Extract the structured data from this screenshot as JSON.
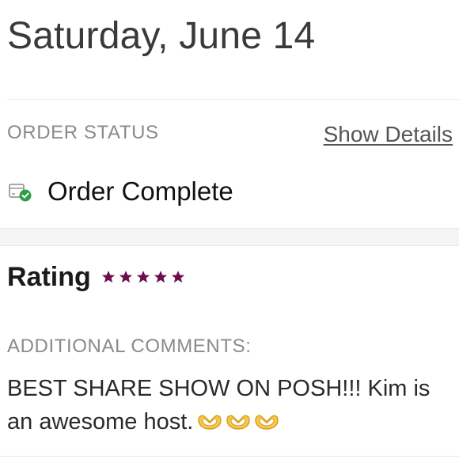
{
  "header": {
    "date": "Saturday, June 14"
  },
  "order_status": {
    "label": "ORDER STATUS",
    "show_details_label": "Show Details",
    "status_text": "Order Complete",
    "icon": "box-check-icon",
    "check_color": "#2e9d46"
  },
  "rating": {
    "label": "Rating",
    "stars": 5,
    "max_stars": 5,
    "star_color": "#6b0f4c"
  },
  "comments": {
    "label": "ADDITIONAL COMMENTS:",
    "text": "BEST SHARE SHOW ON POSH!!! Kim is an awesome host.",
    "emojis": [
      "heart-hands-icon",
      "heart-hands-icon",
      "heart-hands-icon"
    ]
  }
}
